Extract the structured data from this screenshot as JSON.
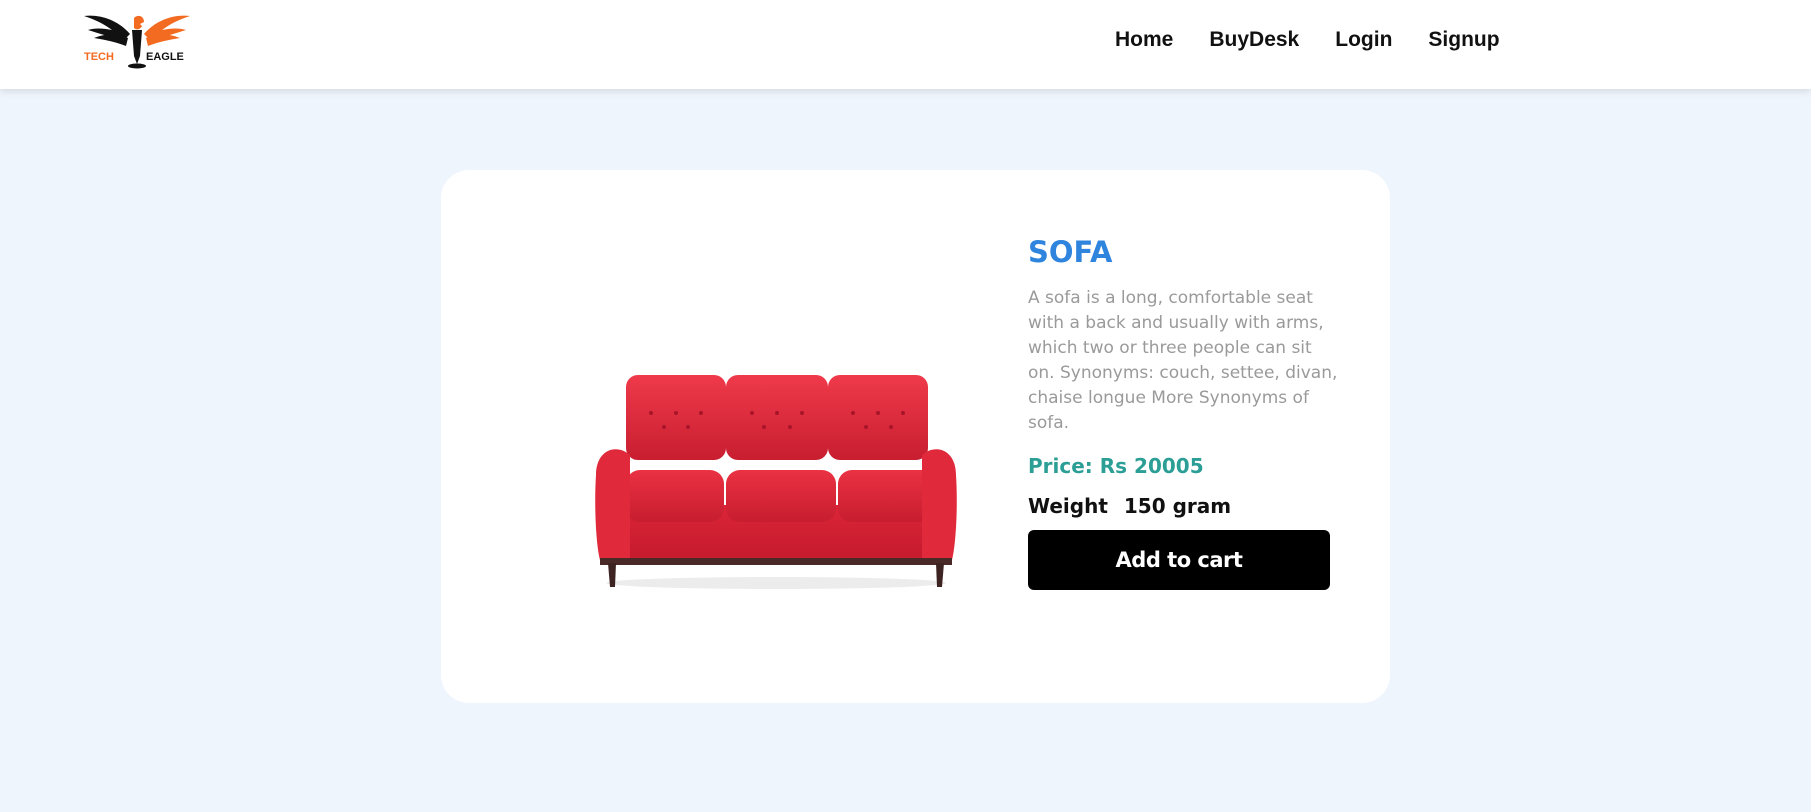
{
  "header": {
    "logo": {
      "text_left": "TECH",
      "text_right": "EAGLE",
      "icon": "eagle-logo-icon",
      "colors": {
        "orange": "#f26b21",
        "black": "#111111"
      }
    },
    "nav": [
      {
        "label": "Home"
      },
      {
        "label": "BuyDesk"
      },
      {
        "label": "Login"
      },
      {
        "label": "Signup"
      }
    ]
  },
  "product": {
    "image_icon": "red-sofa-image",
    "title": "SOFA",
    "description": "A sofa is a long, comfortable seat with a back and usually with arms, which two or three people can sit on. Synonyms: couch, settee, divan, chaise longue More Synonyms of sofa.",
    "price_text": "Price: Rs 20005",
    "weight_label": "Weight",
    "weight_value": "150 gram",
    "add_to_cart_label": "Add to cart"
  },
  "colors": {
    "page_background": "#eff5fd",
    "title": "#2f84dd",
    "price": "#2b9e95",
    "description": "#9a9a9a",
    "button": "#000000",
    "sofa": "#e0283a"
  }
}
